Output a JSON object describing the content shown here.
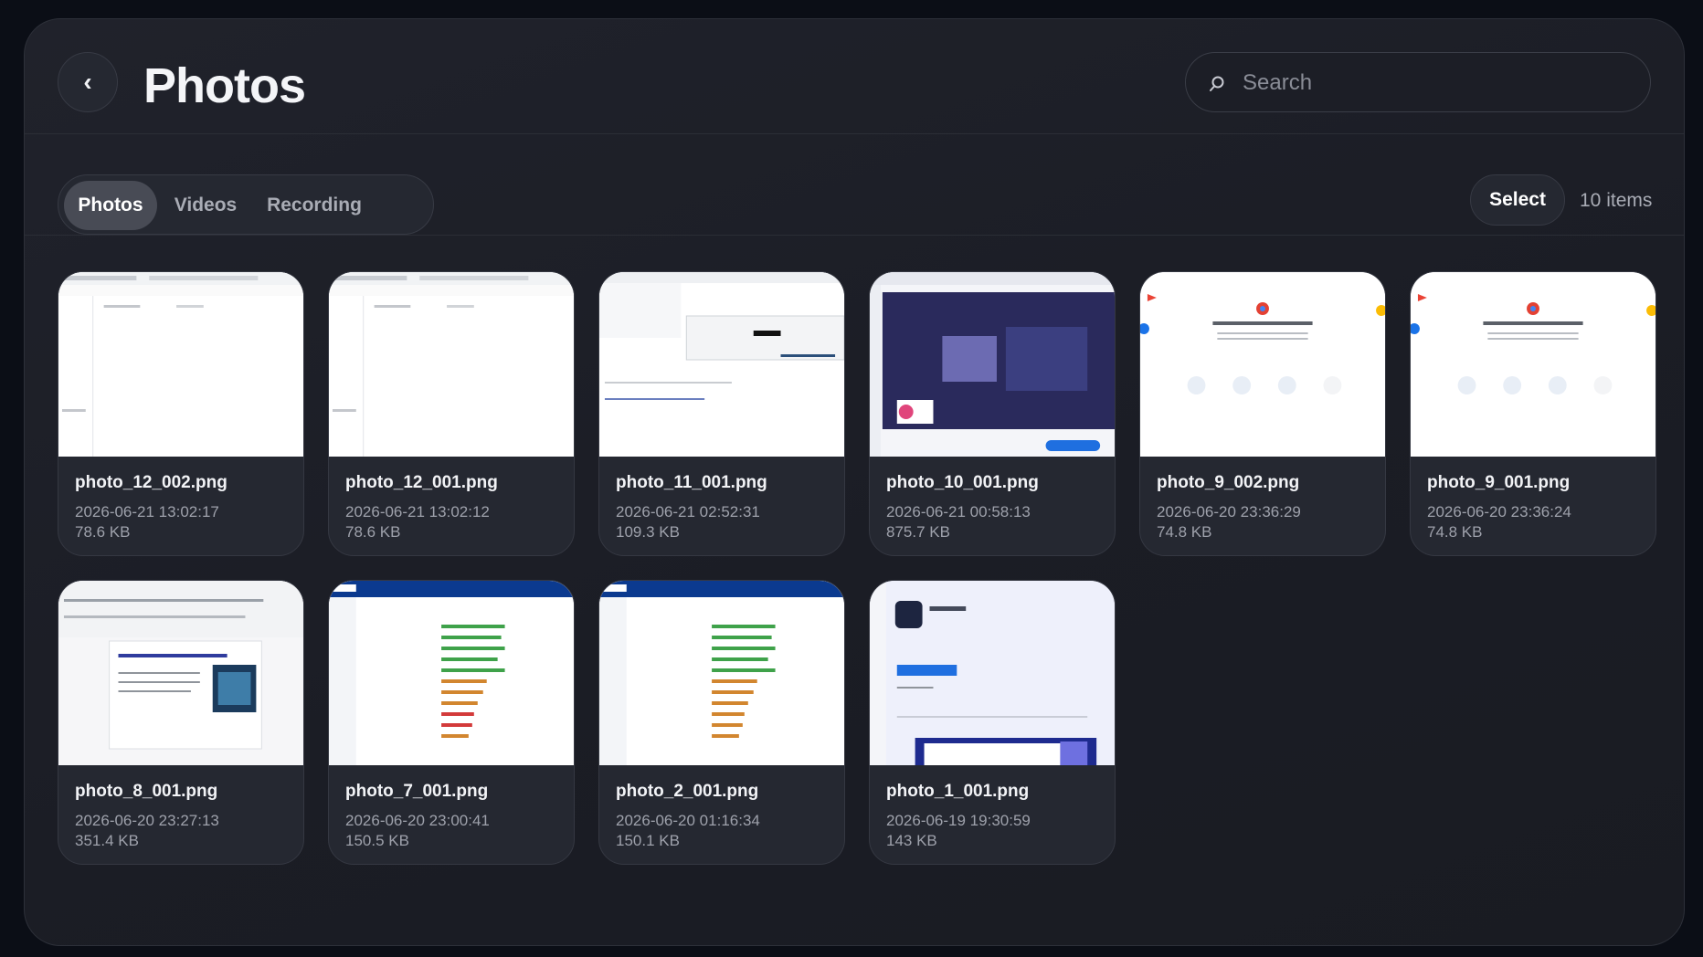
{
  "header": {
    "back_glyph": "‹",
    "title": "Photos",
    "search_placeholder": "Search",
    "search_icon": "search-icon"
  },
  "tabs": [
    {
      "label": "Photos",
      "active": true
    },
    {
      "label": "Videos",
      "active": false
    },
    {
      "label": "Recording",
      "active": false
    }
  ],
  "toolbar": {
    "select_label": "Select",
    "item_count": "10 items"
  },
  "photos": [
    {
      "name": "photo_12_002.png",
      "date": "2026-06-21 13:02:17",
      "size": "78.6 KB"
    },
    {
      "name": "photo_12_001.png",
      "date": "2026-06-21 13:02:12",
      "size": "78.6 KB"
    },
    {
      "name": "photo_11_001.png",
      "date": "2026-06-21 02:52:31",
      "size": "109.3 KB"
    },
    {
      "name": "photo_10_001.png",
      "date": "2026-06-21 00:58:13",
      "size": "875.7 KB"
    },
    {
      "name": "photo_9_002.png",
      "date": "2026-06-20 23:36:29",
      "size": "74.8 KB"
    },
    {
      "name": "photo_9_001.png",
      "date": "2026-06-20 23:36:24",
      "size": "74.8 KB"
    },
    {
      "name": "photo_8_001.png",
      "date": "2026-06-20 23:27:13",
      "size": "351.4 KB"
    },
    {
      "name": "photo_7_001.png",
      "date": "2026-06-20 23:00:41",
      "size": "150.5 KB"
    },
    {
      "name": "photo_2_001.png",
      "date": "2026-06-20 01:16:34",
      "size": "150.1 KB"
    },
    {
      "name": "photo_1_001.png",
      "date": "2026-06-19 19:30:59",
      "size": "143 KB"
    }
  ],
  "colors": {
    "background": "#0b0e16",
    "panel": "#1e2028",
    "active_tab": "#484b55",
    "text_primary": "#f2f3f6",
    "text_secondary": "#9ea1ab"
  }
}
